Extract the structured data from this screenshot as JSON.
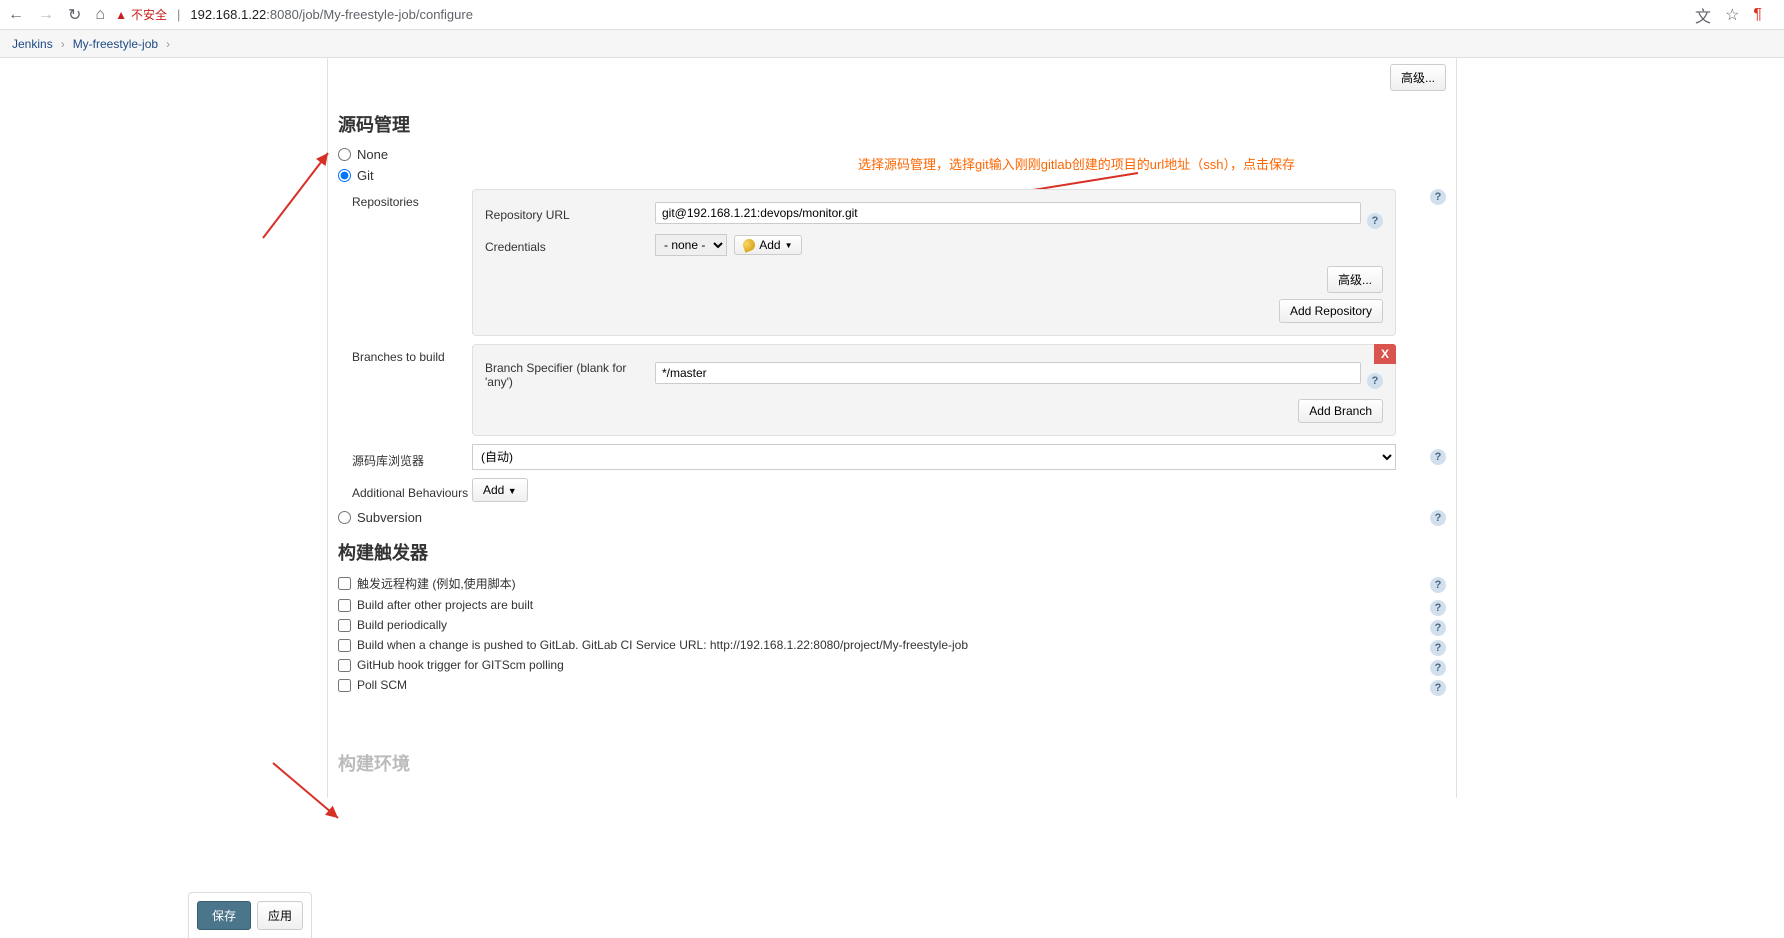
{
  "browser": {
    "insecure_label": "不安全",
    "url_host": "192.168.1.22",
    "url_port_path": ":8080/job/My-freestyle-job/configure"
  },
  "breadcrumb": {
    "root": "Jenkins",
    "job": "My-freestyle-job"
  },
  "buttons": {
    "advanced": "高级...",
    "add_repository": "Add Repository",
    "add_branch": "Add Branch",
    "add_cred": "Add",
    "add_behaviour": "Add",
    "save": "保存",
    "apply": "应用"
  },
  "sections": {
    "scm_title": "源码管理",
    "triggers_title": "构建触发器",
    "build_env_ghost": "构建环境"
  },
  "annotation": "选择源码管理，选择git输入刚刚gitlab创建的项目的url地址（ssh），点击保存",
  "scm": {
    "none_label": "None",
    "git_label": "Git",
    "subversion_label": "Subversion",
    "repositories_label": "Repositories",
    "repo_url_label": "Repository URL",
    "repo_url_value": "git@192.168.1.21:devops/monitor.git",
    "credentials_label": "Credentials",
    "credentials_selected": "- none -",
    "branches_label": "Branches to build",
    "branch_specifier_label": "Branch Specifier (blank for 'any')",
    "branch_specifier_value": "*/master",
    "repo_browser_label": "源码库浏览器",
    "repo_browser_selected": "(自动)",
    "addl_behaviours_label": "Additional Behaviours",
    "delete_x": "X"
  },
  "triggers": {
    "remote": "触发远程构建 (例如,使用脚本)",
    "after_projects": "Build after other projects are built",
    "periodically": "Build periodically",
    "gitlab_push": "Build when a change is pushed to GitLab. GitLab CI Service URL: http://192.168.1.22:8080/project/My-freestyle-job",
    "github_hook": "GitHub hook trigger for GITScm polling",
    "poll_scm": "Poll SCM"
  }
}
